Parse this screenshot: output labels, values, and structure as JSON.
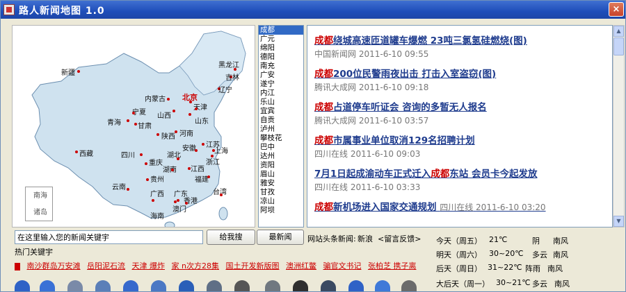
{
  "window": {
    "title": "路人新闻地图 1.0",
    "close": "×"
  },
  "map": {
    "inset_label_1": "南海",
    "inset_label_2": "诸岛",
    "capital": "北京",
    "cities": [
      "黑龙江",
      "吉林",
      "辽宁",
      "新疆",
      "内蒙古",
      "宁夏",
      "山西",
      "天津",
      "山东",
      "青海",
      "甘肃",
      "陕西",
      "河南",
      "西藏",
      "四川",
      "安徽",
      "江苏",
      "上海",
      "湖北",
      "重庆",
      "浙江",
      "湖南",
      "江西",
      "贵州",
      "福建",
      "云南",
      "广西",
      "广东",
      "香港",
      "台湾",
      "澳门",
      "海南"
    ]
  },
  "city_list": {
    "selected": "成都",
    "items": [
      "广元",
      "绵阳",
      "德阳",
      "南充",
      "广安",
      "遂宁",
      "内江",
      "乐山",
      "宜宾",
      "自贡",
      "泸州",
      "攀枝花",
      "巴中",
      "达州",
      "资阳",
      "眉山",
      "雅安",
      "甘孜",
      "凉山",
      "阿坝"
    ]
  },
  "news": [
    {
      "hl": "成都",
      "rest": "绕城高速匝道罐车爆燃 23吨三氯氢硅燃烧(图)",
      "pre": "",
      "source": "中国新闻网",
      "time": "2011-6-10 09:55"
    },
    {
      "hl": "成都",
      "rest": "200位民警雨夜出击 打击入室盗窃(图)",
      "pre": "",
      "source": "腾讯大成网",
      "time": "2011-6-10 09:18"
    },
    {
      "hl": "成都",
      "rest": "占道停车听证会 咨询的多暂无人报名",
      "pre": "",
      "source": "腾讯大成网",
      "time": "2011-6-10 03:57"
    },
    {
      "hl": "成都",
      "rest": "市属事业单位取消129名招聘计划",
      "pre": "",
      "source": "四川在线",
      "time": "2011-6-10 09:03"
    },
    {
      "hl": "成都",
      "rest": "东站 会员卡今起发放",
      "pre": "7月1日起成渝动车正式迁入",
      "source": "四川在线",
      "time": "2011-6-10 03:33"
    },
    {
      "hl": "成都",
      "rest": "新机场进入国家交通规划",
      "pre": "",
      "source": "四川在线",
      "time": "2011-6-10 03:20"
    }
  ],
  "search": {
    "value": "在这里输入您的新闻关键宇"
  },
  "buttons": {
    "search": "给我搜",
    "latest": "最新闻"
  },
  "site": {
    "label": "网站头条新闻:",
    "link1": "新浪",
    "link2": "<留言反馈>"
  },
  "hot": {
    "label": "热门关键宇",
    "keywords": [
      "南沙群岛万安滩",
      "岳阳泥石流",
      "天津 爆炸",
      "家 n次方28集",
      "国土开发新版图",
      "澳洲红鳖",
      "骗官文书记",
      "张柏芝 携子离"
    ]
  },
  "weather": [
    {
      "day": "今天（周五）",
      "temp": "21℃",
      "cond": "阴",
      "wind": "南风"
    },
    {
      "day": "明天（周六）",
      "temp": "30~20℃",
      "cond": "多云",
      "wind": "南风"
    },
    {
      "day": "后天（周日）",
      "temp": "31~22℃",
      "cond": "阵雨",
      "wind": "南风"
    },
    {
      "day": "大后天（周一）",
      "temp": "30~21℃",
      "cond": "多云",
      "wind": "南风"
    }
  ],
  "toolbar_icons": [
    "globe-icon",
    "tools-icon",
    "film-icon",
    "monitor-icon",
    "globe-icon",
    "tools-icon",
    "play-icon",
    "monitor-icon",
    "clapper-icon",
    "tools-icon",
    "clapper-icon",
    "monitor-icon",
    "globe-icon",
    "browser-icon",
    "gear-icon"
  ],
  "colors": {
    "accent": "#c00000",
    "link": "#1f3c8e",
    "selection": "#316ac5",
    "titlebar": "#1f4eb9"
  }
}
